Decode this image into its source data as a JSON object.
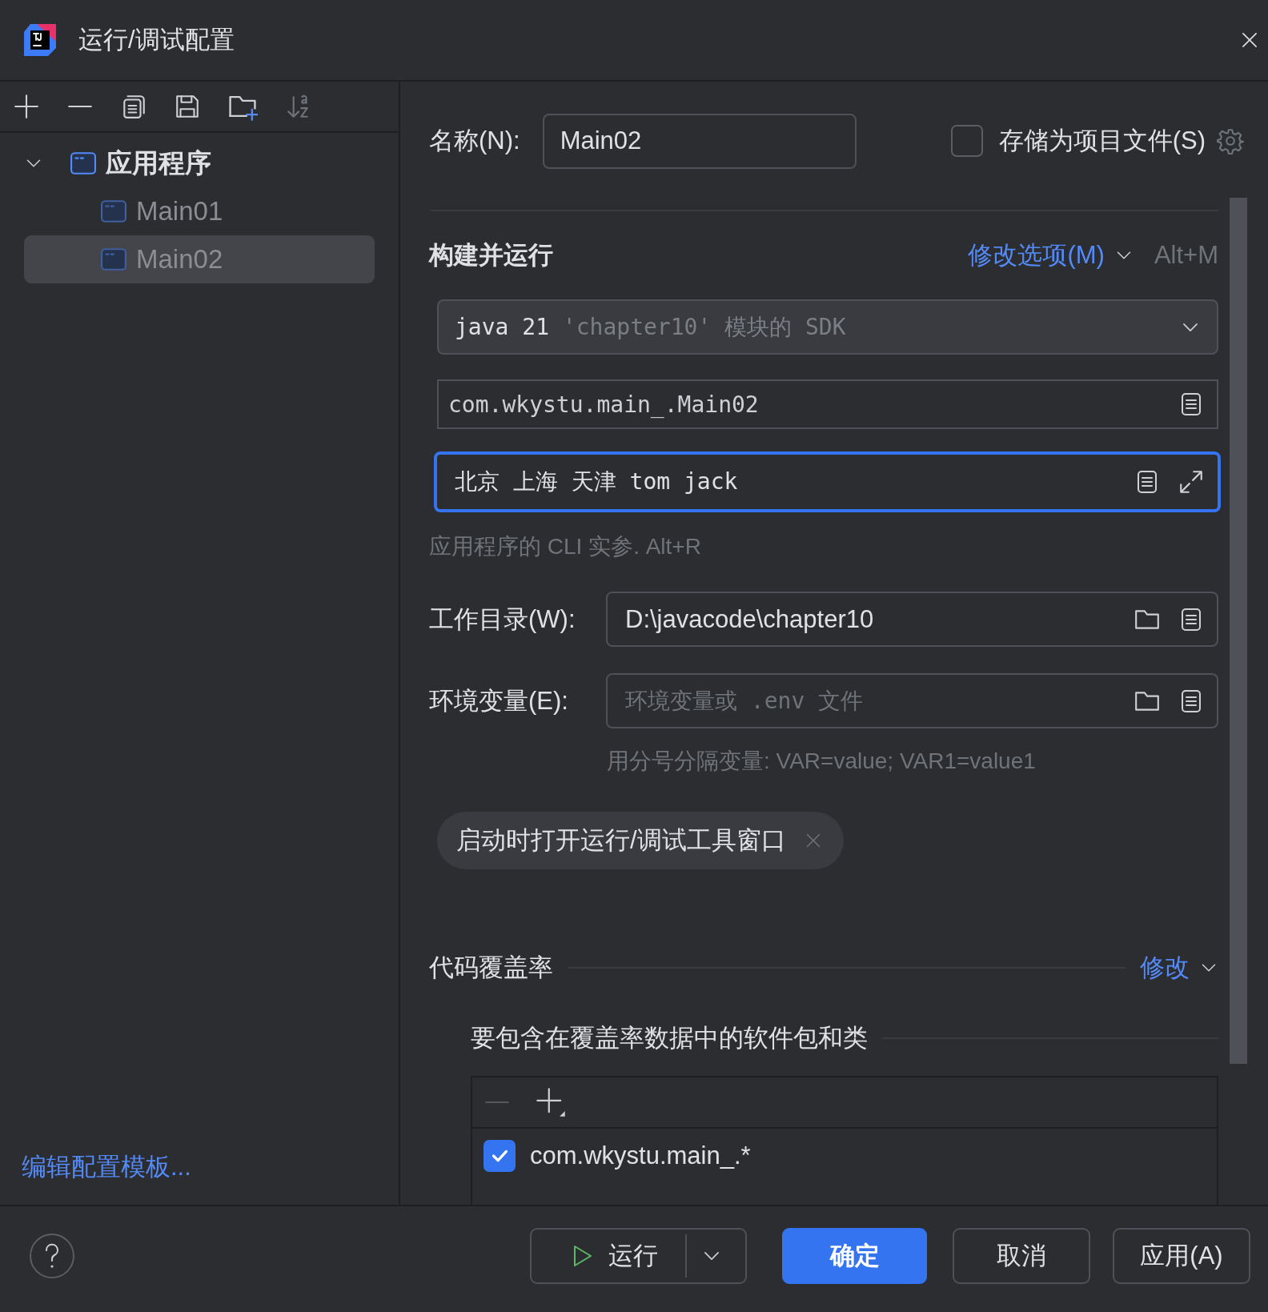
{
  "window": {
    "title": "运行/调试配置"
  },
  "tree": [
    {
      "label": "应用程序",
      "expanded": true,
      "selected": false,
      "children": [
        {
          "label": "Main01",
          "selected": false
        },
        {
          "label": "Main02",
          "selected": true
        }
      ]
    }
  ],
  "templates_link": "编辑配置模板...",
  "name_field": {
    "label": "名称(N):",
    "value": "Main02"
  },
  "store_as_file": {
    "label": "存储为项目文件(S)",
    "checked": false
  },
  "section": {
    "title": "构建并运行",
    "modify_options": "修改选项(M)",
    "shortcut": "Alt+M"
  },
  "sdk": {
    "value": "java 21",
    "hint": "'chapter10' 模块的 SDK"
  },
  "main_class": {
    "value": "com.wkystu.main_.Main02"
  },
  "program_args": {
    "value": "北京 上海 天津 tom jack",
    "focused": true
  },
  "args_hint": "应用程序的 CLI 实参. Alt+R",
  "working_dir": {
    "label": "工作目录(W):",
    "value": "D:\\javacode\\chapter10"
  },
  "env": {
    "label": "环境变量(E):",
    "placeholder": "环境变量或 .env 文件"
  },
  "env_hint": "用分号分隔变量: VAR=value; VAR1=value1",
  "chips": [
    {
      "label": "启动时打开运行/调试工具窗口"
    }
  ],
  "coverage": {
    "title": "代码覆盖率",
    "modify": "修改",
    "subtitle": "要包含在覆盖率数据中的软件包和类",
    "rows": [
      {
        "pattern": "com.wkystu.main_.*",
        "checked": true
      }
    ]
  },
  "buttons": [
    {
      "label": "运行",
      "kind": "split"
    },
    {
      "label": "确定",
      "kind": "primary"
    },
    {
      "label": "取消",
      "kind": "normal"
    },
    {
      "label": "应用(A)",
      "kind": "normal"
    }
  ]
}
